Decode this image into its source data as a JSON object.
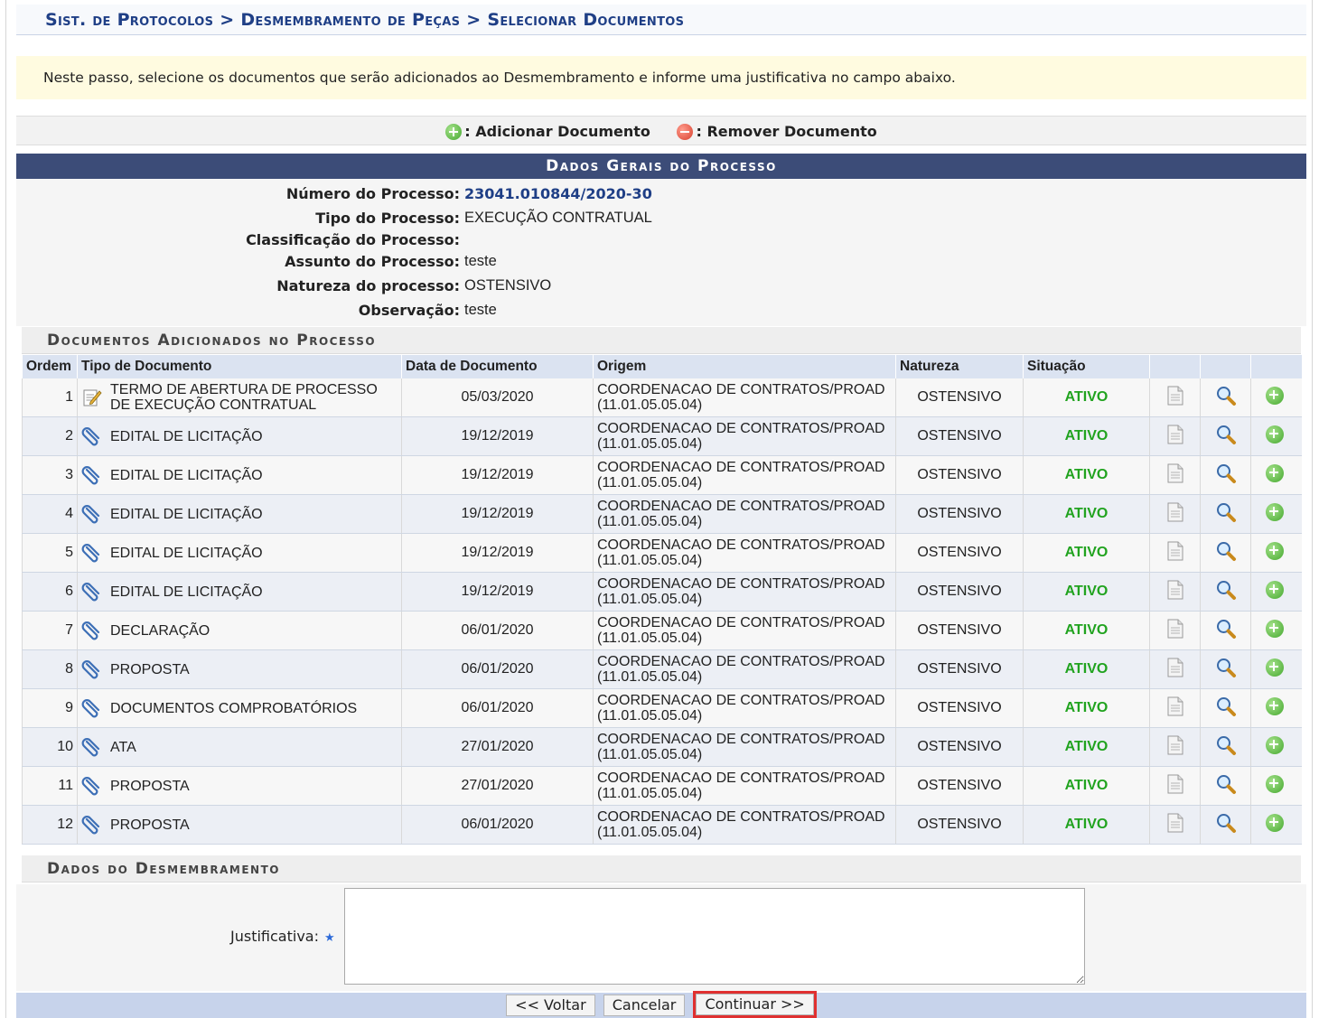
{
  "breadcrumb": "Sist. de Protocolos > Desmembramento de Peças > Selecionar Documentos",
  "notice": "Neste passo, selecione os documentos que serão adicionados ao Desmembramento e informe uma justificativa no campo abaixo.",
  "legend": {
    "add_label": ": Adicionar Documento",
    "remove_label": ": Remover Documento"
  },
  "process": {
    "header": "Dados Gerais do Processo",
    "fields": [
      {
        "label": "Número do Processo:",
        "value": "23041.010844/2020-30"
      },
      {
        "label": "Tipo do Processo:",
        "value": "EXECUÇÃO CONTRATUAL"
      },
      {
        "label": "Classificação do Processo:",
        "value": ""
      },
      {
        "label": "Assunto do Processo:",
        "value": "teste"
      },
      {
        "label": "Natureza do processo:",
        "value": "OSTENSIVO"
      },
      {
        "label": "Observação:",
        "value": "teste"
      }
    ]
  },
  "documents": {
    "header": "Documentos Adicionados no Processo",
    "columns": [
      "Ordem",
      "Tipo de Documento",
      "Data de Documento",
      "Origem",
      "Natureza",
      "Situação"
    ],
    "rows": [
      {
        "ordem": "1",
        "tipo": "TERMO DE ABERTURA DE PROCESSO DE EXECUÇÃO CONTRATUAL",
        "icon": "edit-note-icon",
        "data": "05/03/2020",
        "origem1": "COORDENACAO DE CONTRATOS/PROAD",
        "origem2": "(11.01.05.05.04)",
        "natureza": "OSTENSIVO",
        "situacao": "ATIVO"
      },
      {
        "ordem": "2",
        "tipo": "EDITAL DE LICITAÇÃO",
        "icon": "paperclip-icon",
        "data": "19/12/2019",
        "origem1": "COORDENACAO DE CONTRATOS/PROAD",
        "origem2": "(11.01.05.05.04)",
        "natureza": "OSTENSIVO",
        "situacao": "ATIVO"
      },
      {
        "ordem": "3",
        "tipo": "EDITAL DE LICITAÇÃO",
        "icon": "paperclip-icon",
        "data": "19/12/2019",
        "origem1": "COORDENACAO DE CONTRATOS/PROAD",
        "origem2": "(11.01.05.05.04)",
        "natureza": "OSTENSIVO",
        "situacao": "ATIVO"
      },
      {
        "ordem": "4",
        "tipo": "EDITAL DE LICITAÇÃO",
        "icon": "paperclip-icon",
        "data": "19/12/2019",
        "origem1": "COORDENACAO DE CONTRATOS/PROAD",
        "origem2": "(11.01.05.05.04)",
        "natureza": "OSTENSIVO",
        "situacao": "ATIVO"
      },
      {
        "ordem": "5",
        "tipo": "EDITAL DE LICITAÇÃO",
        "icon": "paperclip-icon",
        "data": "19/12/2019",
        "origem1": "COORDENACAO DE CONTRATOS/PROAD",
        "origem2": "(11.01.05.05.04)",
        "natureza": "OSTENSIVO",
        "situacao": "ATIVO"
      },
      {
        "ordem": "6",
        "tipo": "EDITAL DE LICITAÇÃO",
        "icon": "paperclip-icon",
        "data": "19/12/2019",
        "origem1": "COORDENACAO DE CONTRATOS/PROAD",
        "origem2": "(11.01.05.05.04)",
        "natureza": "OSTENSIVO",
        "situacao": "ATIVO"
      },
      {
        "ordem": "7",
        "tipo": "DECLARAÇÃO",
        "icon": "paperclip-icon",
        "data": "06/01/2020",
        "origem1": "COORDENACAO DE CONTRATOS/PROAD",
        "origem2": "(11.01.05.05.04)",
        "natureza": "OSTENSIVO",
        "situacao": "ATIVO"
      },
      {
        "ordem": "8",
        "tipo": "PROPOSTA",
        "icon": "paperclip-icon",
        "data": "06/01/2020",
        "origem1": "COORDENACAO DE CONTRATOS/PROAD",
        "origem2": "(11.01.05.05.04)",
        "natureza": "OSTENSIVO",
        "situacao": "ATIVO"
      },
      {
        "ordem": "9",
        "tipo": "DOCUMENTOS COMPROBATÓRIOS",
        "icon": "paperclip-icon",
        "data": "06/01/2020",
        "origem1": "COORDENACAO DE CONTRATOS/PROAD",
        "origem2": "(11.01.05.05.04)",
        "natureza": "OSTENSIVO",
        "situacao": "ATIVO"
      },
      {
        "ordem": "10",
        "tipo": "ATA",
        "icon": "paperclip-icon",
        "data": "27/01/2020",
        "origem1": "COORDENACAO DE CONTRATOS/PROAD",
        "origem2": "(11.01.05.05.04)",
        "natureza": "OSTENSIVO",
        "situacao": "ATIVO"
      },
      {
        "ordem": "11",
        "tipo": "PROPOSTA",
        "icon": "paperclip-icon",
        "data": "27/01/2020",
        "origem1": "COORDENACAO DE CONTRATOS/PROAD",
        "origem2": "(11.01.05.05.04)",
        "natureza": "OSTENSIVO",
        "situacao": "ATIVO"
      },
      {
        "ordem": "12",
        "tipo": "PROPOSTA",
        "icon": "paperclip-icon",
        "data": "06/01/2020",
        "origem1": "COORDENACAO DE CONTRATOS/PROAD",
        "origem2": "(11.01.05.05.04)",
        "natureza": "OSTENSIVO",
        "situacao": "ATIVO"
      }
    ]
  },
  "desmembramento": {
    "header": "Dados do Desmembramento",
    "justificativa_label": "Justificativa:",
    "required_mark": "★",
    "justificativa_value": ""
  },
  "buttons": {
    "back": "<< Voltar",
    "cancel": "Cancelar",
    "continue": "Continuar >>"
  },
  "colors": {
    "header_bg": "#3c4c78",
    "link_blue": "#1f3f86",
    "ativo_green": "#21a31f",
    "notice_bg": "#fffbe0",
    "highlight_red": "#e03030"
  }
}
